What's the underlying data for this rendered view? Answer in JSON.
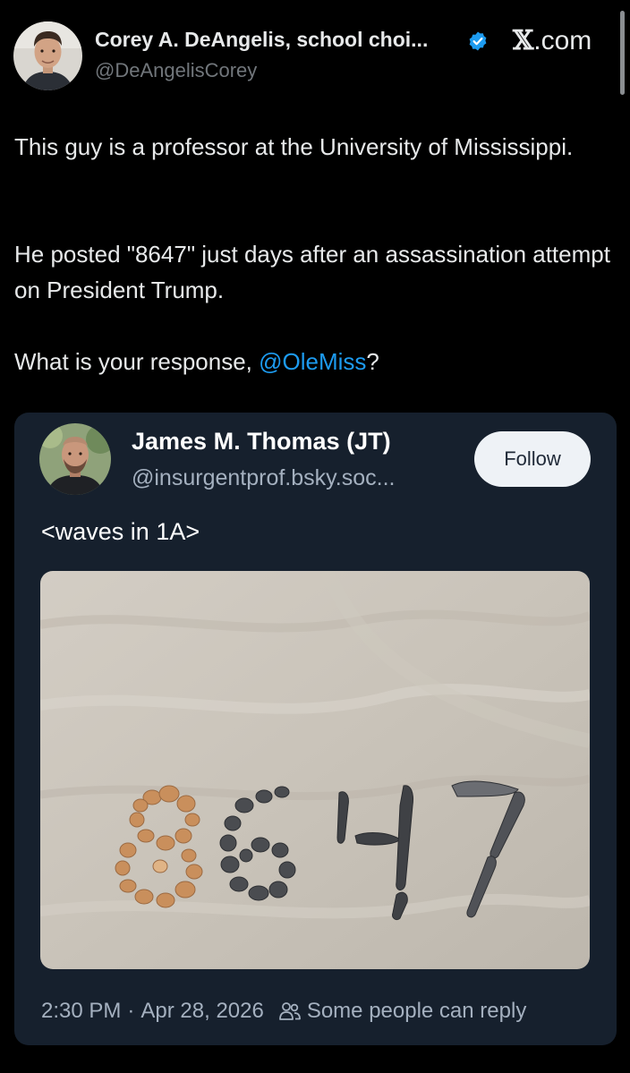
{
  "header": {
    "author_name": "Corey A. DeAngelis, school choi...",
    "author_handle": "@DeAngelisCorey",
    "brand_symbol": "𝕏",
    "brand_suffix": ".com",
    "verified_icon": "verified-badge-icon"
  },
  "tweet": {
    "paragraph1": "This guy is a professor at the University of Mississippi.",
    "paragraph2": "He posted \"8647\" just days after an assassination attempt on President Trump.",
    "paragraph3_prefix": "What is your response, ",
    "paragraph3_mention": "@OleMiss",
    "paragraph3_suffix": "?"
  },
  "embed": {
    "author_name": "James M. Thomas (JT)",
    "author_handle": "@insurgentprof.bsky.soc...",
    "follow_label": "Follow",
    "text": "<waves in 1A>",
    "image_icon": "beach-sand-8647-photo",
    "time": "2:30 PM",
    "separator": "·",
    "date": "Apr 28, 2026",
    "reply_icon": "people-icon",
    "reply_setting": "Some people can reply"
  },
  "colors": {
    "background": "#000000",
    "text": "#e7e9ea",
    "muted": "#71767b",
    "link": "#1d9bf0",
    "verified": "#1d9bf0",
    "card_background": "#16202d",
    "card_muted": "#a4b0bf",
    "follow_button": "#eef2f6"
  }
}
